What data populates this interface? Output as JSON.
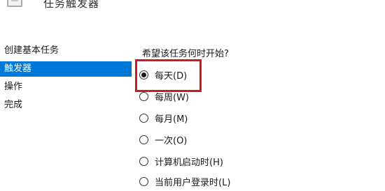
{
  "header": {
    "title": "任务触发器",
    "icon": "task-window-icon"
  },
  "nav": {
    "items": [
      {
        "label": "创建基本任务",
        "selected": false
      },
      {
        "label": "触发器",
        "selected": true
      },
      {
        "label": "操作",
        "selected": false
      },
      {
        "label": "完成",
        "selected": false
      }
    ],
    "selected_color": "#0078d7"
  },
  "trigger": {
    "question": "希望该任务何时开始?",
    "options": [
      {
        "label": "每天(D)",
        "checked": true
      },
      {
        "label": "每周(W)",
        "checked": false
      },
      {
        "label": "每月(M)",
        "checked": false
      },
      {
        "label": "一次(O)",
        "checked": false
      },
      {
        "label": "计算机启动时(H)",
        "checked": false
      },
      {
        "label": "当前用户登录时(L)",
        "checked": false
      }
    ]
  },
  "annotation": {
    "highlight_color": "#d0191f"
  }
}
